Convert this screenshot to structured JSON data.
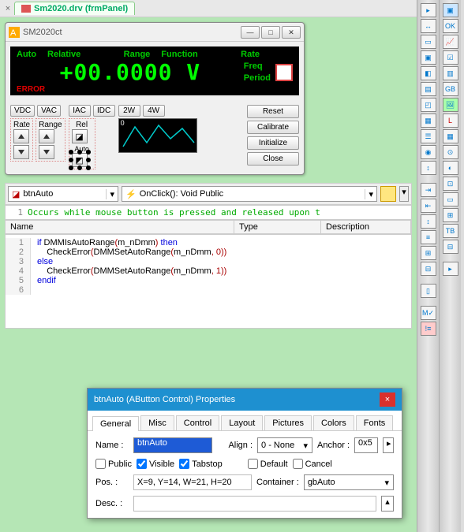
{
  "tab": {
    "label": "Sm2020.drv (frmPanel)"
  },
  "window": {
    "title": "SM2020ct",
    "row1": {
      "auto": "Auto",
      "relative": "Relative",
      "range": "Range",
      "function": "Function",
      "rate": "Rate"
    },
    "value": "+00.0000 V",
    "side": {
      "freq": "Freq",
      "period": "Period"
    },
    "error": "ERROR",
    "mode_buttons": [
      "VDC",
      "VAC",
      "IAC",
      "IDC",
      "2W",
      "4W"
    ],
    "rate_label": "Rate",
    "range_label": "Range",
    "rel_label": "Rel",
    "auto_label": "Auto",
    "plot_zero": "0",
    "right_buttons": [
      "Reset",
      "Calibrate",
      "Initialize",
      "Close"
    ]
  },
  "combo1": "btnAuto",
  "combo2": "OnClick(): Void Public",
  "comment": {
    "num": "1",
    "text": "Occurs while mouse button is pressed and released upon t"
  },
  "grid": {
    "name": "Name",
    "type": "Type",
    "desc": "Description"
  },
  "code": [
    {
      "n": "1",
      "raw": "if DMMIsAutoRange(m_nDmm) then"
    },
    {
      "n": "2",
      "raw": "    CheckError(DMMSetAutoRange(m_nDmm, 0))"
    },
    {
      "n": "3",
      "raw": "else"
    },
    {
      "n": "4",
      "raw": "    CheckError(DMMSetAutoRange(m_nDmm, 1))"
    },
    {
      "n": "5",
      "raw": "endif"
    },
    {
      "n": "6",
      "raw": ""
    }
  ],
  "props": {
    "title": "btnAuto (AButton Control) Properties",
    "tabs": [
      "General",
      "Misc",
      "Control",
      "Layout",
      "Pictures",
      "Colors",
      "Fonts"
    ],
    "name_label": "Name :",
    "name_value": "btnAuto",
    "align_label": "Align :",
    "align_value": "0 - None",
    "anchor_label": "Anchor :",
    "anchor_value": "0x5",
    "public": "Public",
    "visible": "Visible",
    "tabstop": "Tabstop",
    "default": "Default",
    "cancel": "Cancel",
    "pos_label": "Pos. :",
    "pos_value": "X=9, Y=14, W=21, H=20",
    "container_label": "Container :",
    "container_value": "gbAuto",
    "desc_label": "Desc. :",
    "desc_value": ""
  }
}
